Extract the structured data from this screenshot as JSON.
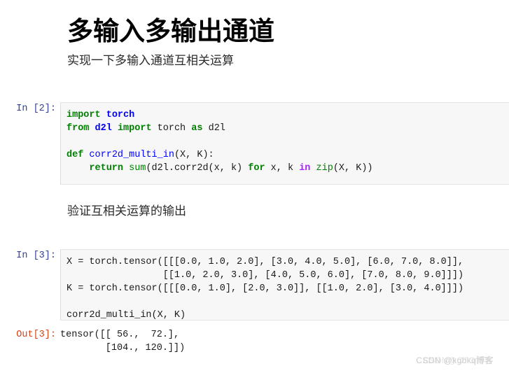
{
  "notebook": {
    "markdown_header": {
      "title": "多输入多输出通道",
      "subtitle": "实现一下多输入通道互相关运算"
    },
    "markdown_middle": {
      "text": "验证互相关运算的输出"
    },
    "cells": [
      {
        "prompt": "In [2]:",
        "type": "code",
        "code_lines": [
          "import torch",
          "from d2l import torch as d2l",
          "",
          "def corr2d_multi_in(X, K):",
          "    return sum(d2l.corr2d(x, k) for x, k in zip(X, K))"
        ]
      },
      {
        "prompt": "In [3]:",
        "type": "code",
        "code_lines": [
          "X = torch.tensor([[[0.0, 1.0, 2.0], [3.0, 4.0, 5.0], [6.0, 7.0, 8.0]],",
          "                 [[1.0, 2.0, 3.0], [4.0, 5.0, 6.0], [7.0, 8.0, 9.0]]])",
          "K = torch.tensor([[[0.0, 1.0], [2.0, 3.0]], [[1.0, 2.0], [3.0, 4.0]]])",
          "",
          "corr2d_multi_in(X, K)"
        ]
      },
      {
        "prompt": "Out[3]:",
        "type": "output",
        "output_lines": [
          "tensor([[ 56.,  72.],",
          "        [104., 120.]])"
        ]
      }
    ],
    "tokens": {
      "import": "import",
      "from": "from",
      "as": "as",
      "def": "def",
      "return": "return",
      "in": "in",
      "torch": "torch",
      "d2l": "d2l",
      "func_name": "corr2d_multi_in",
      "sum": "sum",
      "zip": "zip"
    },
    "colors": {
      "keyword": "#008000",
      "operator_word": "#aa22ff",
      "name_namespace": "#0000ff",
      "builtin": "#008000",
      "prompt_in": "#303f9f",
      "prompt_out": "#d84315",
      "code_bg": "#f7f7f7",
      "page_bg": "#ffffff"
    }
  },
  "watermark": {
    "text": "CSDN @kgbkq博客",
    "overlay_text": "CSDN@CTO博客"
  }
}
